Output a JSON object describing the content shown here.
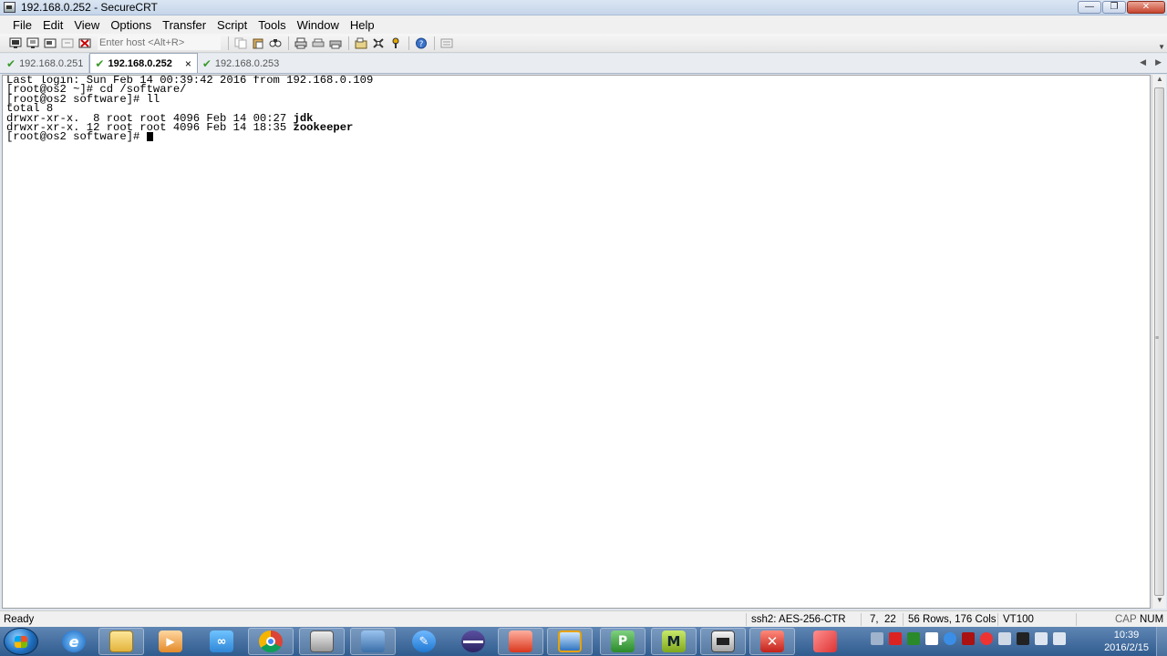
{
  "window": {
    "title": "192.168.0.252 - SecureCRT",
    "min_glyph": "—",
    "max_glyph": "❐",
    "close_glyph": "✕"
  },
  "menu": [
    "File",
    "Edit",
    "View",
    "Options",
    "Transfer",
    "Script",
    "Tools",
    "Window",
    "Help"
  ],
  "toolbar": {
    "host_placeholder": "Enter host <Alt+R>"
  },
  "tabs": [
    {
      "label": "192.168.0.251",
      "active": false
    },
    {
      "label": "192.168.0.252",
      "active": true,
      "close": "×"
    },
    {
      "label": "192.168.0.253",
      "active": false
    }
  ],
  "tab_nav": {
    "left": "◀",
    "right": "▶"
  },
  "terminal": {
    "lines": [
      "Last login: Sun Feb 14 00:39:42 2016 from 192.168.0.109",
      "[root@os2 ~]# cd /software/",
      "[root@os2 software]# ll",
      "total 8"
    ],
    "entries": [
      {
        "perms": "drwxr-xr-x.  8 root root 4096 Feb 14 00:27 ",
        "name": "jdk"
      },
      {
        "perms": "drwxr-xr-x. 12 root root 4096 Feb 14 18:35 ",
        "name": "zookeeper"
      }
    ],
    "prompt": "[root@os2 software]# "
  },
  "status": {
    "ready": "Ready",
    "cipher": "ssh2: AES-256-CTR",
    "position": "7,  22",
    "size": "56 Rows, 176 Cols",
    "emulation": "VT100",
    "cap": "CAP",
    "num": "NUM"
  },
  "taskbar": {
    "time": "10:39",
    "date": "2016/2/15"
  },
  "colors": {
    "tab_check": "#3a9a2a",
    "taskbar": "#2f5b8e"
  }
}
